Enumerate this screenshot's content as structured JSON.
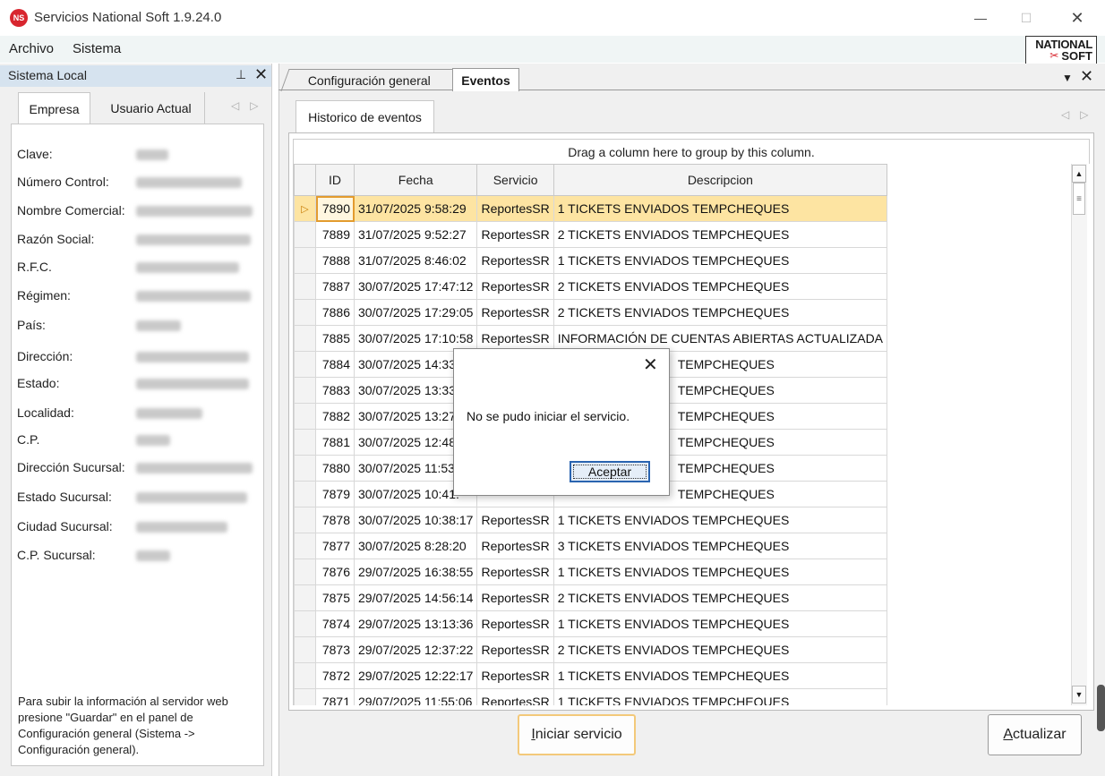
{
  "window": {
    "logo_text": "NS",
    "title": "Servicios National Soft 1.9.24.0",
    "min_glyph": "—",
    "max_glyph": "☐",
    "close_glyph": "✕"
  },
  "menu": {
    "archivo": "Archivo",
    "sistema": "Sistema"
  },
  "brand": {
    "line1": "NATIONAL",
    "line2": "SOFT",
    "mark": "✂"
  },
  "left_panel": {
    "title": "Sistema Local",
    "pin_glyph": "⊥",
    "close_glyph": "✕",
    "tabs": [
      "Empresa",
      "Usuario Actual"
    ],
    "tab_arrows": "◁▷",
    "fields": [
      {
        "label": "Clave:"
      },
      {
        "label": "Número Control:"
      },
      {
        "label": "Nombre Comercial:"
      },
      {
        "label": "Razón Social:"
      },
      {
        "label": "R.F.C."
      },
      {
        "label": "Régimen:"
      },
      {
        "label": "País:"
      },
      {
        "label": "Dirección:"
      },
      {
        "label": "Estado:"
      },
      {
        "label": "Localidad:"
      },
      {
        "label": "C.P."
      },
      {
        "label": "Dirección Sucursal:"
      },
      {
        "label": "Estado Sucursal:"
      },
      {
        "label": "Ciudad Sucursal:"
      },
      {
        "label": "C.P. Sucursal:"
      }
    ],
    "note": "Para subir la información al servidor web presione \"Guardar\" en el panel de Configuración general (Sistema -> Configuración general)."
  },
  "right_panel": {
    "doc_tabs": [
      "Configuración general",
      "Eventos"
    ],
    "dropdown_glyph": "▼",
    "close_glyph": "✕",
    "inner_tab": "Historico de eventos",
    "inner_tab_arrows": "◁▷"
  },
  "grid": {
    "group_hint": "Drag a column here to group by this column.",
    "columns": [
      "ID",
      "Fecha",
      "Servicio",
      "Descripcion"
    ],
    "selected_indicator": "▷",
    "rows": [
      {
        "id": "7890",
        "fecha": "31/07/2025 9:58:29",
        "servicio": "ReportesSR",
        "descripcion": "1 TICKETS ENVIADOS TEMPCHEQUES"
      },
      {
        "id": "7889",
        "fecha": "31/07/2025 9:52:27",
        "servicio": "ReportesSR",
        "descripcion": "2 TICKETS ENVIADOS TEMPCHEQUES"
      },
      {
        "id": "7888",
        "fecha": "31/07/2025 8:46:02",
        "servicio": "ReportesSR",
        "descripcion": "1 TICKETS ENVIADOS TEMPCHEQUES"
      },
      {
        "id": "7887",
        "fecha": "30/07/2025 17:47:12",
        "servicio": "ReportesSR",
        "descripcion": "2 TICKETS ENVIADOS TEMPCHEQUES"
      },
      {
        "id": "7886",
        "fecha": "30/07/2025 17:29:05",
        "servicio": "ReportesSR",
        "descripcion": "2 TICKETS ENVIADOS TEMPCHEQUES"
      },
      {
        "id": "7885",
        "fecha": "30/07/2025 17:10:58",
        "servicio": "ReportesSR",
        "descripcion": "INFORMACIÓN DE CUENTAS ABIERTAS ACTUALIZADA"
      },
      {
        "id": "7884",
        "fecha": "30/07/2025 14:33:",
        "servicio": "",
        "descripcion": "TEMPCHEQUES"
      },
      {
        "id": "7883",
        "fecha": "30/07/2025 13:33:",
        "servicio": "",
        "descripcion": "TEMPCHEQUES"
      },
      {
        "id": "7882",
        "fecha": "30/07/2025 13:27:",
        "servicio": "",
        "descripcion": "TEMPCHEQUES"
      },
      {
        "id": "7881",
        "fecha": "30/07/2025 12:48:",
        "servicio": "",
        "descripcion": "TEMPCHEQUES"
      },
      {
        "id": "7880",
        "fecha": "30/07/2025 11:53:",
        "servicio": "",
        "descripcion": "TEMPCHEQUES"
      },
      {
        "id": "7879",
        "fecha": "30/07/2025 10:41:",
        "servicio": "",
        "descripcion": "TEMPCHEQUES"
      },
      {
        "id": "7878",
        "fecha": "30/07/2025 10:38:17",
        "servicio": "ReportesSR",
        "descripcion": "1 TICKETS ENVIADOS TEMPCHEQUES"
      },
      {
        "id": "7877",
        "fecha": "30/07/2025 8:28:20",
        "servicio": "ReportesSR",
        "descripcion": "3 TICKETS ENVIADOS TEMPCHEQUES"
      },
      {
        "id": "7876",
        "fecha": "29/07/2025 16:38:55",
        "servicio": "ReportesSR",
        "descripcion": "1 TICKETS ENVIADOS TEMPCHEQUES"
      },
      {
        "id": "7875",
        "fecha": "29/07/2025 14:56:14",
        "servicio": "ReportesSR",
        "descripcion": "2 TICKETS ENVIADOS TEMPCHEQUES"
      },
      {
        "id": "7874",
        "fecha": "29/07/2025 13:13:36",
        "servicio": "ReportesSR",
        "descripcion": "1 TICKETS ENVIADOS TEMPCHEQUES"
      },
      {
        "id": "7873",
        "fecha": "29/07/2025 12:37:22",
        "servicio": "ReportesSR",
        "descripcion": "2 TICKETS ENVIADOS TEMPCHEQUES"
      },
      {
        "id": "7872",
        "fecha": "29/07/2025 12:22:17",
        "servicio": "ReportesSR",
        "descripcion": "1 TICKETS ENVIADOS TEMPCHEQUES"
      },
      {
        "id": "7871",
        "fecha": "29/07/2025 11:55:06",
        "servicio": "ReportesSR",
        "descripcion": "1 TICKETS ENVIADOS TEMPCHEQUES"
      }
    ],
    "scroll_up_glyph": "▲",
    "scroll_down_glyph": "▼",
    "scroll_thumb_glyph": "≡"
  },
  "buttons": {
    "iniciar_first": "I",
    "iniciar_rest": "niciar servicio",
    "actualizar_first": "A",
    "actualizar_rest": "ctualizar"
  },
  "dialog": {
    "close_glyph": "✕",
    "message": "No se pudo iniciar el servicio.",
    "ok": "Aceptar"
  },
  "colors": {
    "selected_row": "#fde4a2",
    "panel_header": "#d6e3ef",
    "logo_red": "#d8262f"
  }
}
